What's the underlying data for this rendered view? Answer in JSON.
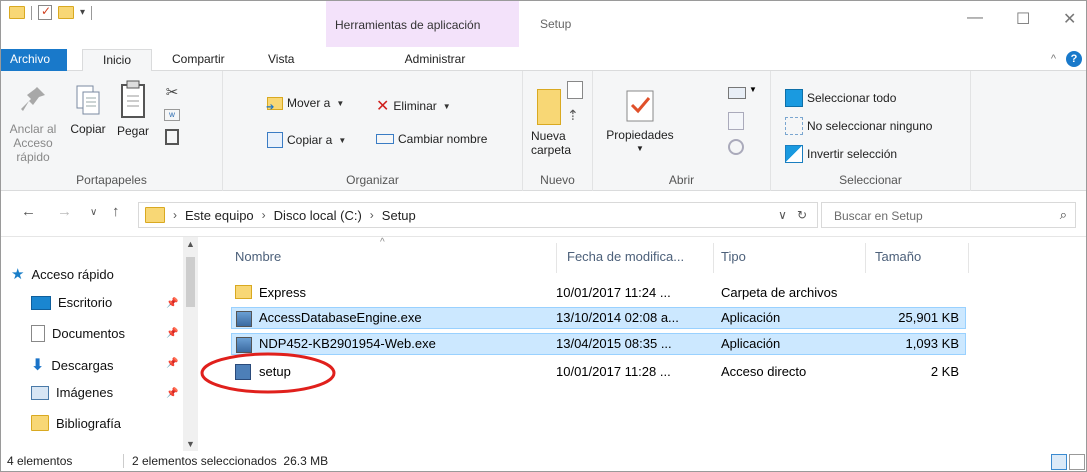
{
  "titlebar": {
    "context_tab": "Herramientas de aplicación",
    "window_title": "Setup",
    "minimize": "—",
    "maximize": "☐",
    "close": "✕"
  },
  "tabs": {
    "file": "Archivo",
    "home": "Inicio",
    "share": "Compartir",
    "view": "Vista",
    "manage": "Administrar",
    "help": "?"
  },
  "ribbon": {
    "clipboard": {
      "label": "Portapapeles",
      "pin_label_1": "Anclar al",
      "pin_label_2": "Acceso rápido",
      "copy": "Copiar",
      "paste": "Pegar"
    },
    "organize": {
      "label": "Organizar",
      "move_to": "Mover a",
      "copy_to": "Copiar a",
      "delete": "Eliminar",
      "rename": "Cambiar nombre"
    },
    "new": {
      "label": "Nuevo",
      "new_folder_1": "Nueva",
      "new_folder_2": "carpeta"
    },
    "open": {
      "label": "Abrir",
      "properties": "Propiedades"
    },
    "select": {
      "label": "Seleccionar",
      "select_all": "Seleccionar todo",
      "select_none": "No seleccionar ninguno",
      "invert": "Invertir selección"
    }
  },
  "address": {
    "crumbs": [
      "Este equipo",
      "Disco local (C:)",
      "Setup"
    ],
    "search_placeholder": "Buscar en Setup"
  },
  "nav_pane": {
    "quick_access": "Acceso rápido",
    "items": [
      "Escritorio",
      "Documentos",
      "Descargas",
      "Imágenes",
      "Bibliografía"
    ]
  },
  "columns": {
    "name": "Nombre",
    "date": "Fecha de modifica...",
    "type": "Tipo",
    "size": "Tamaño"
  },
  "files": [
    {
      "name": "Express",
      "date": "10/01/2017 11:24 ...",
      "type": "Carpeta de archivos",
      "size": ""
    },
    {
      "name": "AccessDatabaseEngine.exe",
      "date": "13/10/2014 02:08 a...",
      "type": "Aplicación",
      "size": "25,901 KB"
    },
    {
      "name": "NDP452-KB2901954-Web.exe",
      "date": "13/04/2015 08:35 ...",
      "type": "Aplicación",
      "size": "1,093 KB"
    },
    {
      "name": "setup",
      "date": "10/01/2017 11:28 ...",
      "type": "Acceso directo",
      "size": "2 KB"
    }
  ],
  "status": {
    "count": "4 elementos",
    "selection": "2 elementos seleccionados  26.3 MB"
  },
  "colors": {
    "accent": "#1979ca",
    "selection_bg": "#cce8ff",
    "selection_border": "#99d1ff",
    "context_tab": "#f3e2fa",
    "highlight_circle": "#e0201c"
  }
}
